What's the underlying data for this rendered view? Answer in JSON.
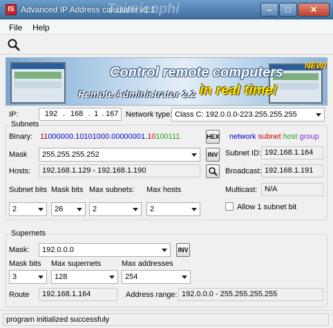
{
  "window": {
    "title": "Advanced IP Address calculator v1.1",
    "icon_text": "IS",
    "watermark": "Taimienphi",
    "controls": {
      "minimize": "–",
      "maximize": "□",
      "close": "✕"
    }
  },
  "menu": {
    "file": "File",
    "help": "Help"
  },
  "toolbar": {
    "search_icon": "search-icon"
  },
  "banner": {
    "slogan_line1": "Control remote computers",
    "product": "Remote Administrator 2.2",
    "slogan_line2": "in real time!",
    "badge": "NEW!"
  },
  "ip": {
    "label": "IP:",
    "octets": [
      "192",
      "168",
      "1",
      "167"
    ],
    "network_type_label": "Network type:",
    "network_type_value": "Class C: 192.0.0.0-223.255.255.255"
  },
  "subnets": {
    "group_title": "Subnets",
    "binary_label": "Binary:",
    "binary_parts": [
      {
        "text": "11",
        "role": "network"
      },
      {
        "text": "000000.10101000.00000001.",
        "role": "network-blue"
      },
      {
        "text": "10",
        "role": "subnet"
      },
      {
        "text": "100111.",
        "role": "host"
      }
    ],
    "hex_button": "HEX",
    "legend": {
      "network": "network",
      "subnet": "subnet",
      "host": "host",
      "group": "group"
    },
    "mask_label": "Mask",
    "mask_value": "255.255.255.252",
    "inv_button": "INV",
    "subnet_id_label": "Subnet ID:",
    "subnet_id_value": "192.168.1.164",
    "hosts_label": "Hosts:",
    "hosts_value": "192.168.1.129 - 192.168.1.190",
    "broadcast_label": "Broadcast:",
    "broadcast_value": "192.168.1.191",
    "subnet_bits_label": "Subnet bits",
    "mask_bits_label": "Mask bits",
    "max_subnets_label": "Max subnets:",
    "max_hosts_label": "Max hosts",
    "subnet_bits_value": "2",
    "mask_bits_value": "26",
    "max_subnets_value": "2",
    "max_hosts_value": "2",
    "multicast_label": "Multicast:",
    "multicast_value": "N/A",
    "allow_checkbox_label": "Allow 1 subnet bit"
  },
  "supernets": {
    "group_title": "Supernets",
    "mask_label": "Mask:",
    "mask_value": "192.0.0.0",
    "inv_button": "INV",
    "mask_bits_label": "Mask bits",
    "max_supernets_label": "Max supernets",
    "max_addresses_label": "Max addresses",
    "mask_bits_value": "3",
    "max_supernets_value": "128",
    "max_addresses_value": "254",
    "route_label": "Route",
    "route_value": "192.168.1.164",
    "address_range_label": "Address range:",
    "address_range_value": "192.0.0.0 - 255.255.255.255"
  },
  "status": {
    "text": "program initialized successfuly"
  },
  "colors": {
    "network": "#8b0000",
    "network_blue": "#0000cc",
    "subnet": "#cc0000",
    "host": "#1f9e1f",
    "group": "#8a2be2",
    "legend_network": "#0000cc"
  }
}
